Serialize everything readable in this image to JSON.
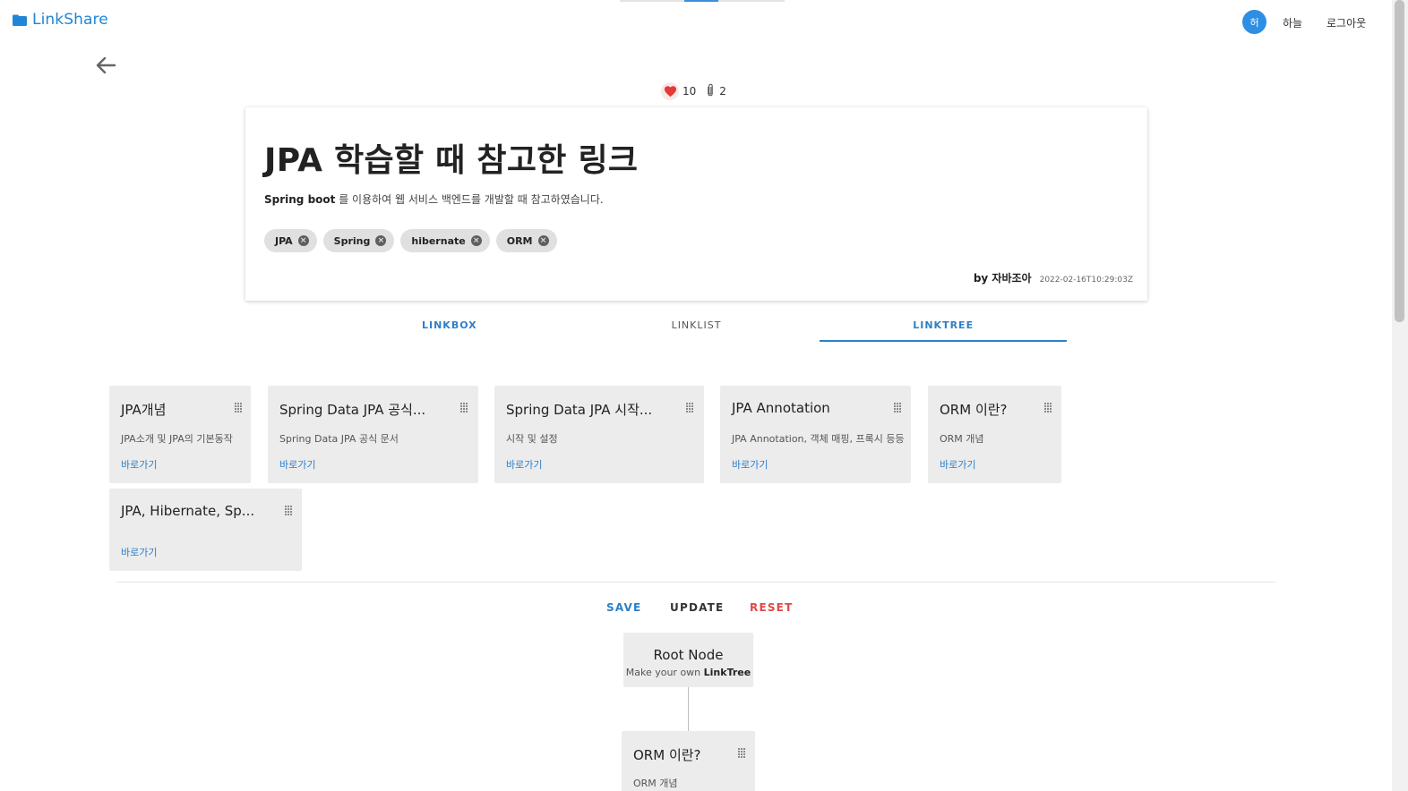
{
  "app": {
    "brand": "LinkShare"
  },
  "header": {
    "avatar_initial": "허",
    "username": "하늘",
    "logout_label": "로그아웃"
  },
  "post": {
    "likes": "10",
    "attachments": "2",
    "title": "JPA 학습할 때 참고한 링크",
    "desc_bold": "Spring boot",
    "desc_rest": " 를 이용하여 웹 서비스 백엔드를 개발할 때 참고하였습니다.",
    "tags": [
      "JPA",
      "Spring",
      "hibernate",
      "ORM"
    ],
    "author": "by 자바조아",
    "date": "2022-02-16T10:29:03Z"
  },
  "tabs": [
    "LINKBOX",
    "LINKLIST",
    "LINKTREE"
  ],
  "active_tab": "LINKTREE",
  "links": [
    {
      "title": "JPA개념",
      "desc": "JPA소개 및 JPA의 기본동작",
      "link": "바로가기"
    },
    {
      "title": "Spring Data JPA 공식...",
      "desc": "Spring Data JPA 공식 문서",
      "link": "바로가기"
    },
    {
      "title": "Spring Data JPA 시작...",
      "desc": "시작 및 설정",
      "link": "바로가기"
    },
    {
      "title": "JPA Annotation",
      "desc": "JPA Annotation, 객체 매핑, 프록시 등등",
      "link": "바로가기"
    },
    {
      "title": "ORM 이란?",
      "desc": "ORM 개념",
      "link": "바로가기"
    },
    {
      "title": "JPA, Hibernate, Sp...",
      "desc": "",
      "link": "바로가기"
    }
  ],
  "tree_actions": {
    "save": "SAVE",
    "update": "UPDATE",
    "reset": "RESET"
  },
  "tree": {
    "root_title": "Root Node",
    "root_sub_prefix": "Make your own ",
    "root_sub_bold": "LinkTree",
    "child": {
      "title": "ORM 이란?",
      "desc": "ORM 개념"
    }
  },
  "colors": {
    "accent": "#2d7fc9",
    "brand": "#2186d6",
    "reset": "#e04848",
    "heart": "#e53935"
  }
}
